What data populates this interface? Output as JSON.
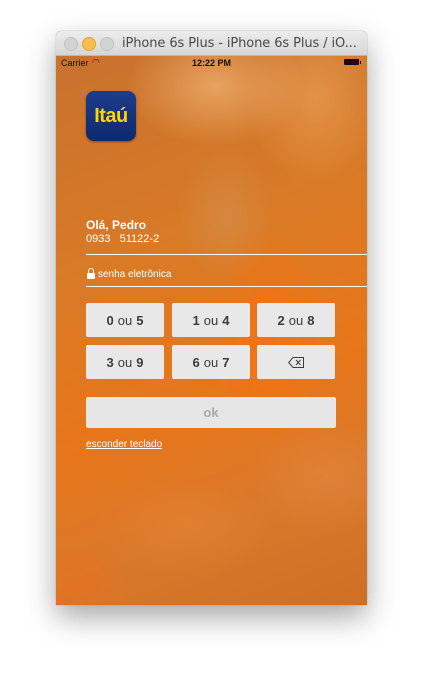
{
  "window": {
    "title": "iPhone 6s Plus - iPhone 6s Plus / iO..."
  },
  "statusbar": {
    "carrier": "Carrier",
    "time": "12:22 PM"
  },
  "logo": {
    "text": "Itaú",
    "text_color": "#ffd400",
    "bg_color": "#0e2a6e"
  },
  "user": {
    "name": "Olá, Pedro",
    "account": "0933   51122-2"
  },
  "password": {
    "label": "senha eletrônica"
  },
  "keypad": {
    "separator": "ou",
    "keys": [
      {
        "a": "0",
        "b": "5"
      },
      {
        "a": "1",
        "b": "4"
      },
      {
        "a": "2",
        "b": "8"
      },
      {
        "a": "3",
        "b": "9"
      },
      {
        "a": "6",
        "b": "7"
      }
    ]
  },
  "actions": {
    "ok_label": "ok",
    "hide_keyboard_label": "esconder teclado"
  },
  "colors": {
    "background_orange": "#e8761a",
    "key_bg": "#e8e8e8",
    "ok_text": "#a9a9a9"
  }
}
